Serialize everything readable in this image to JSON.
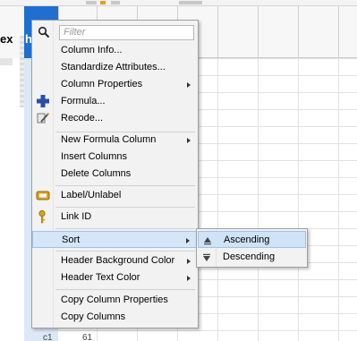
{
  "table": {
    "left_column_label": "ex",
    "selected_column_label": "he",
    "bottom_row_label": "c1",
    "bottom_row_value": "61"
  },
  "menu": {
    "filter_placeholder": "Filter",
    "items": [
      {
        "label": "Column Info...",
        "icon": "",
        "submenu": false
      },
      {
        "label": "Standardize Attributes...",
        "icon": "",
        "submenu": false
      },
      {
        "label": "Column Properties",
        "icon": "",
        "submenu": true
      },
      {
        "label": "Formula...",
        "icon": "plus-cross-icon",
        "submenu": false
      },
      {
        "label": "Recode...",
        "icon": "recode-pencil-icon",
        "submenu": false
      },
      {
        "label": "New Formula Column",
        "icon": "",
        "submenu": true
      },
      {
        "label": "Insert Columns",
        "icon": "",
        "submenu": false
      },
      {
        "label": "Delete Columns",
        "icon": "",
        "submenu": false
      },
      {
        "label": "Label/Unlabel",
        "icon": "label-tag-icon",
        "submenu": false
      },
      {
        "label": "Link ID",
        "icon": "key-icon",
        "submenu": false
      },
      {
        "label": "Sort",
        "icon": "",
        "submenu": true
      },
      {
        "label": "Header Background Color",
        "icon": "",
        "submenu": true
      },
      {
        "label": "Header Text Color",
        "icon": "",
        "submenu": true
      },
      {
        "label": "Copy Column Properties",
        "icon": "",
        "submenu": false
      },
      {
        "label": "Copy Columns",
        "icon": "",
        "submenu": false
      }
    ],
    "active_item": "Sort"
  },
  "sort_submenu": {
    "items": [
      {
        "label": "Ascending",
        "icon": "sort-ascending-icon"
      },
      {
        "label": "Descending",
        "icon": "sort-descending-icon"
      }
    ],
    "active_item": "Ascending"
  },
  "colors": {
    "selected_column": "#1f6fd1",
    "menu_highlight": "#d4e6f7",
    "menu_background": "#f2f2f2",
    "plus_icon": "#2b4fa8",
    "key_icon": "#d8a418",
    "label_icon": "#e0a020"
  }
}
